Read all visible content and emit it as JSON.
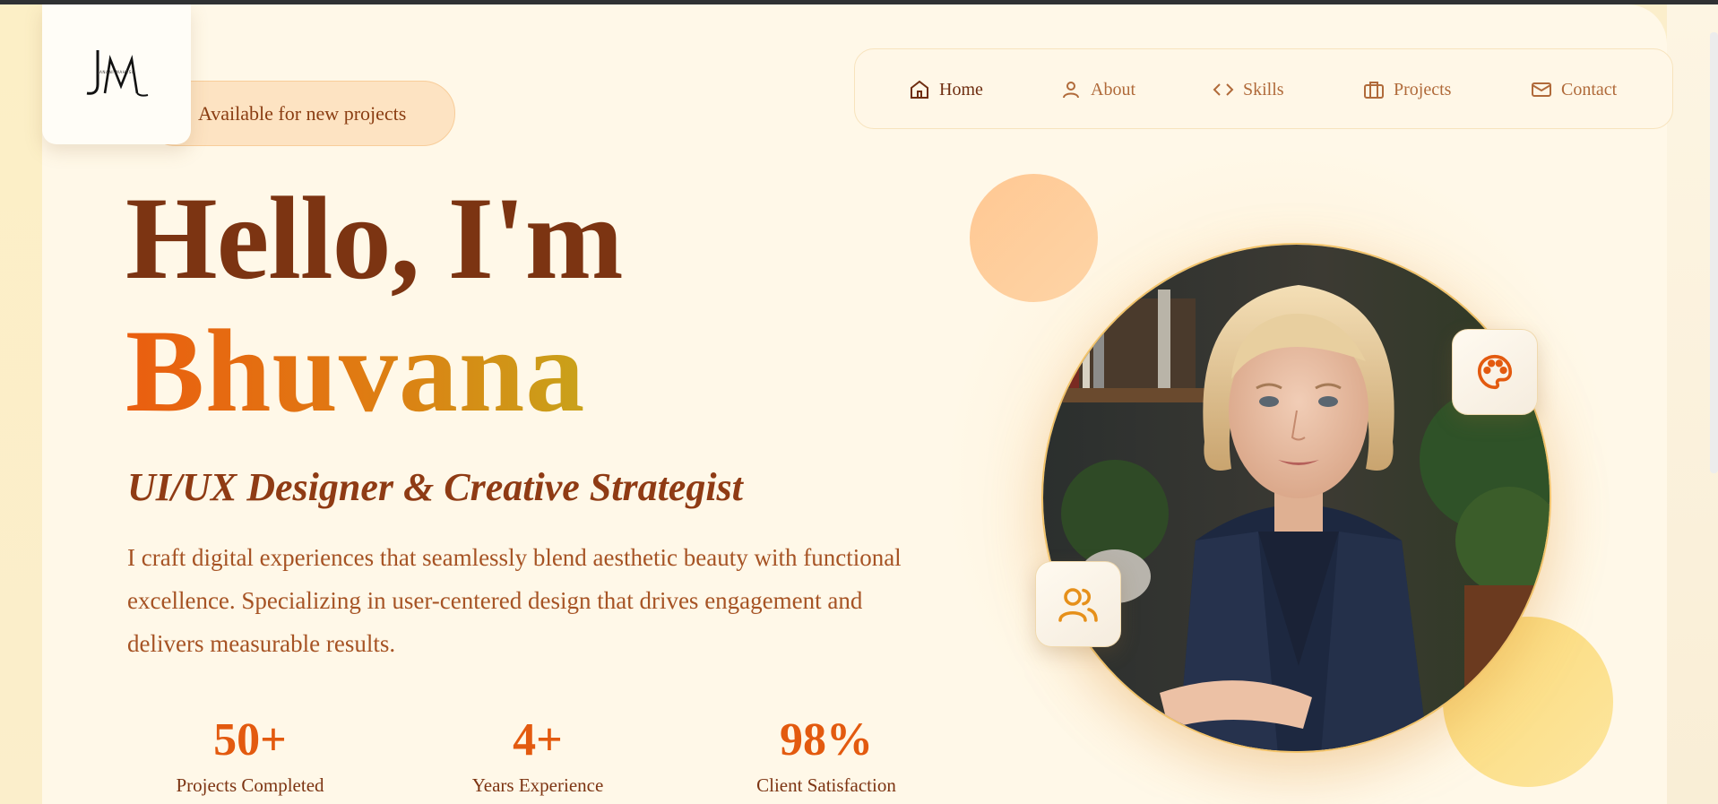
{
  "logo": {
    "monogram": "JM",
    "tagline": "JANANI MAHESH"
  },
  "badge": {
    "text": "Available for new projects"
  },
  "nav": {
    "items": [
      {
        "label": "Home",
        "icon": "home-icon",
        "active": true
      },
      {
        "label": "About",
        "icon": "user-icon",
        "active": false
      },
      {
        "label": "Skills",
        "icon": "code-icon",
        "active": false
      },
      {
        "label": "Projects",
        "icon": "briefcase-icon",
        "active": false
      },
      {
        "label": "Contact",
        "icon": "mail-icon",
        "active": false
      }
    ]
  },
  "hero": {
    "greeting": "Hello, I'm",
    "name": "Bhuvana",
    "role": "UI/UX Designer & Creative Strategist",
    "description": "I craft digital experiences that seamlessly blend aesthetic beauty with functional excellence. Specializing in user-centered design that drives engagement and delivers measurable results."
  },
  "stats": [
    {
      "value": "50+",
      "label": "Projects Completed"
    },
    {
      "value": "4+",
      "label": "Years Experience"
    },
    {
      "value": "98%",
      "label": "Client Satisfaction"
    }
  ],
  "floating_icons": [
    "palette-icon",
    "users-icon"
  ],
  "colors": {
    "accent": "#e35a0f",
    "heading": "#7c3412",
    "background": "#fff8e8",
    "badge_bg": "#fde3c2"
  }
}
